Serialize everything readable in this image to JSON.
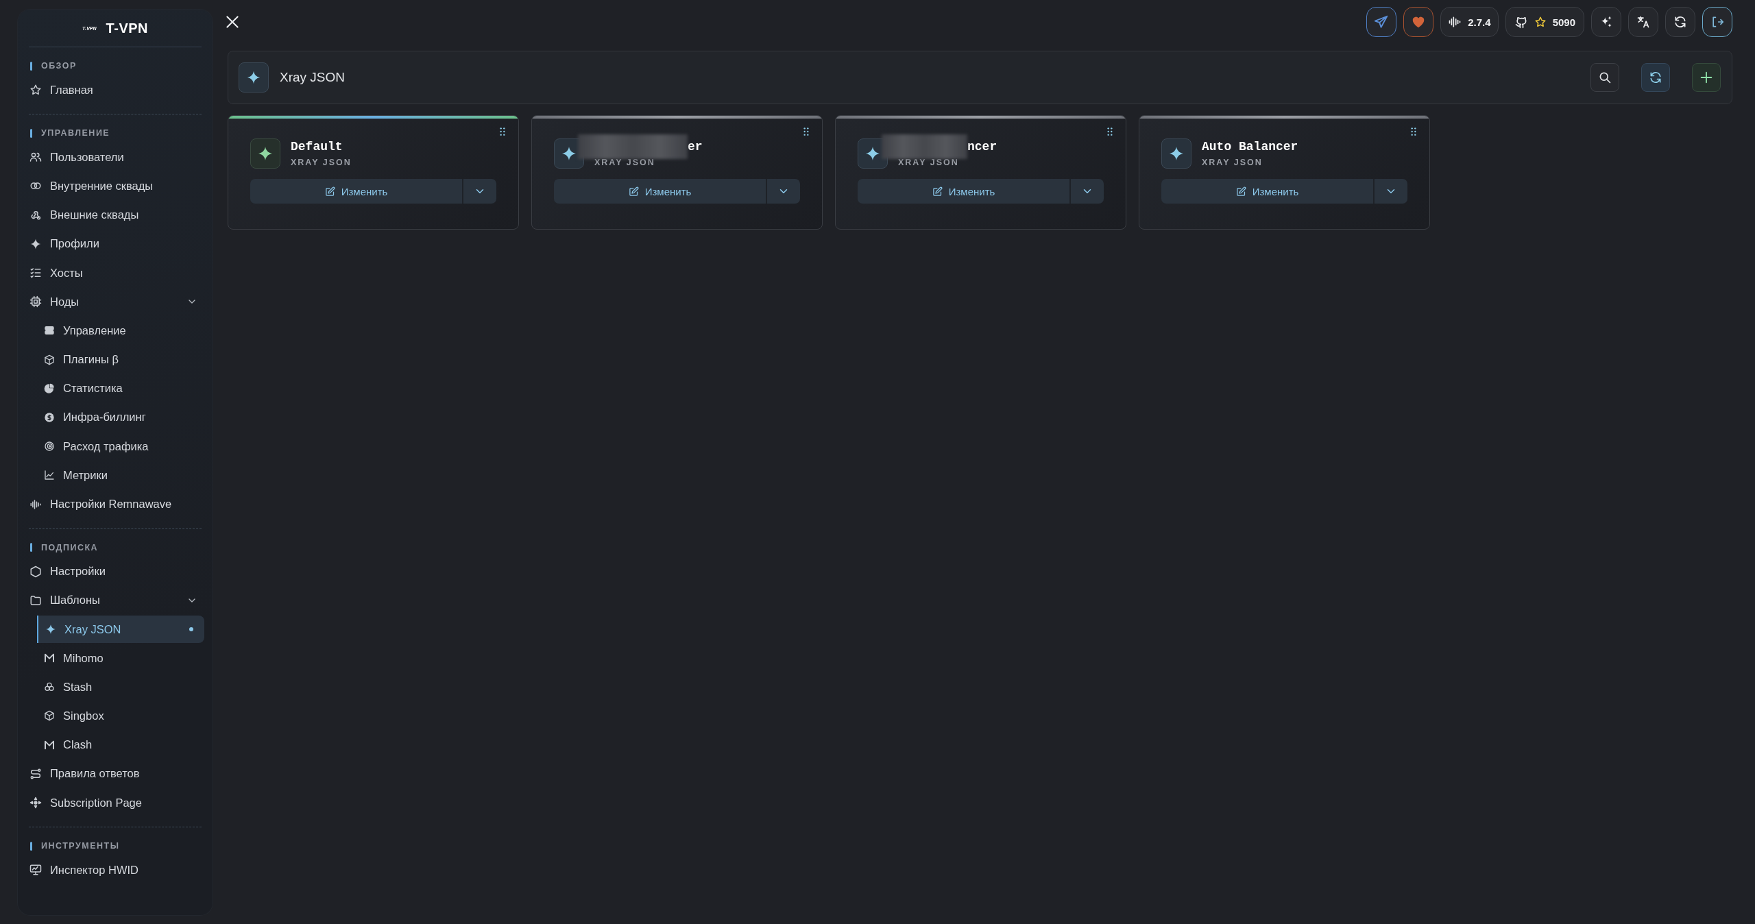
{
  "sidebar": {
    "logo_small": "T-VPN",
    "logo": "T-VPN",
    "sections": [
      {
        "title": "ОБЗОР",
        "items": [
          {
            "label": "Главная",
            "selected": false
          }
        ]
      },
      {
        "title": "УПРАВЛЕНИЕ",
        "items": [
          {
            "label": "Пользователи",
            "selected": false
          },
          {
            "label": "Внутренние сквады",
            "selected": false
          },
          {
            "label": "Внешние сквады",
            "selected": false
          },
          {
            "label": "Профили",
            "selected": false
          },
          {
            "label": "Хосты",
            "selected": false
          },
          {
            "label": "Ноды",
            "selected": false,
            "expanded": true,
            "children": [
              {
                "label": "Управление",
                "selected": false
              },
              {
                "label": "Плагины β",
                "selected": false
              },
              {
                "label": "Статистика",
                "selected": false
              },
              {
                "label": "Инфра-биллинг",
                "selected": false
              },
              {
                "label": "Расход трафика",
                "selected": false
              },
              {
                "label": "Метрики",
                "selected": false
              }
            ]
          },
          {
            "label": "Настройки Remnawave",
            "selected": false
          }
        ]
      },
      {
        "title": "ПОДПИСКА",
        "items": [
          {
            "label": "Настройки",
            "selected": false
          },
          {
            "label": "Шаблоны",
            "selected": false,
            "expanded": true,
            "children": [
              {
                "label": "Xray JSON",
                "selected": true
              },
              {
                "label": "Mihomo",
                "selected": false
              },
              {
                "label": "Stash",
                "selected": false
              },
              {
                "label": "Singbox",
                "selected": false
              },
              {
                "label": "Clash",
                "selected": false
              }
            ]
          },
          {
            "label": "Правила ответов",
            "selected": false
          },
          {
            "label": "Subscription Page",
            "selected": false
          }
        ]
      },
      {
        "title": "ИНСТРУМЕНТЫ",
        "items": [
          {
            "label": "Инспектор HWID",
            "selected": false
          }
        ]
      }
    ]
  },
  "topbar": {
    "version": "2.7.4",
    "github_stars": "5090"
  },
  "page_header": {
    "title": "Xray JSON"
  },
  "cards": [
    {
      "name": "Default",
      "redacted": false,
      "type": "XRAY JSON",
      "selected": true,
      "action": "Изменить"
    },
    {
      "name": "er",
      "redacted": true,
      "type": "XRAY JSON",
      "selected": false,
      "action": "Изменить"
    },
    {
      "name": "ncer",
      "redacted": true,
      "type": "XRAY JSON",
      "selected": false,
      "action": "Изменить"
    },
    {
      "name": "Auto Balancer",
      "redacted": false,
      "type": "XRAY JSON",
      "selected": false,
      "action": "Изменить"
    }
  ]
}
